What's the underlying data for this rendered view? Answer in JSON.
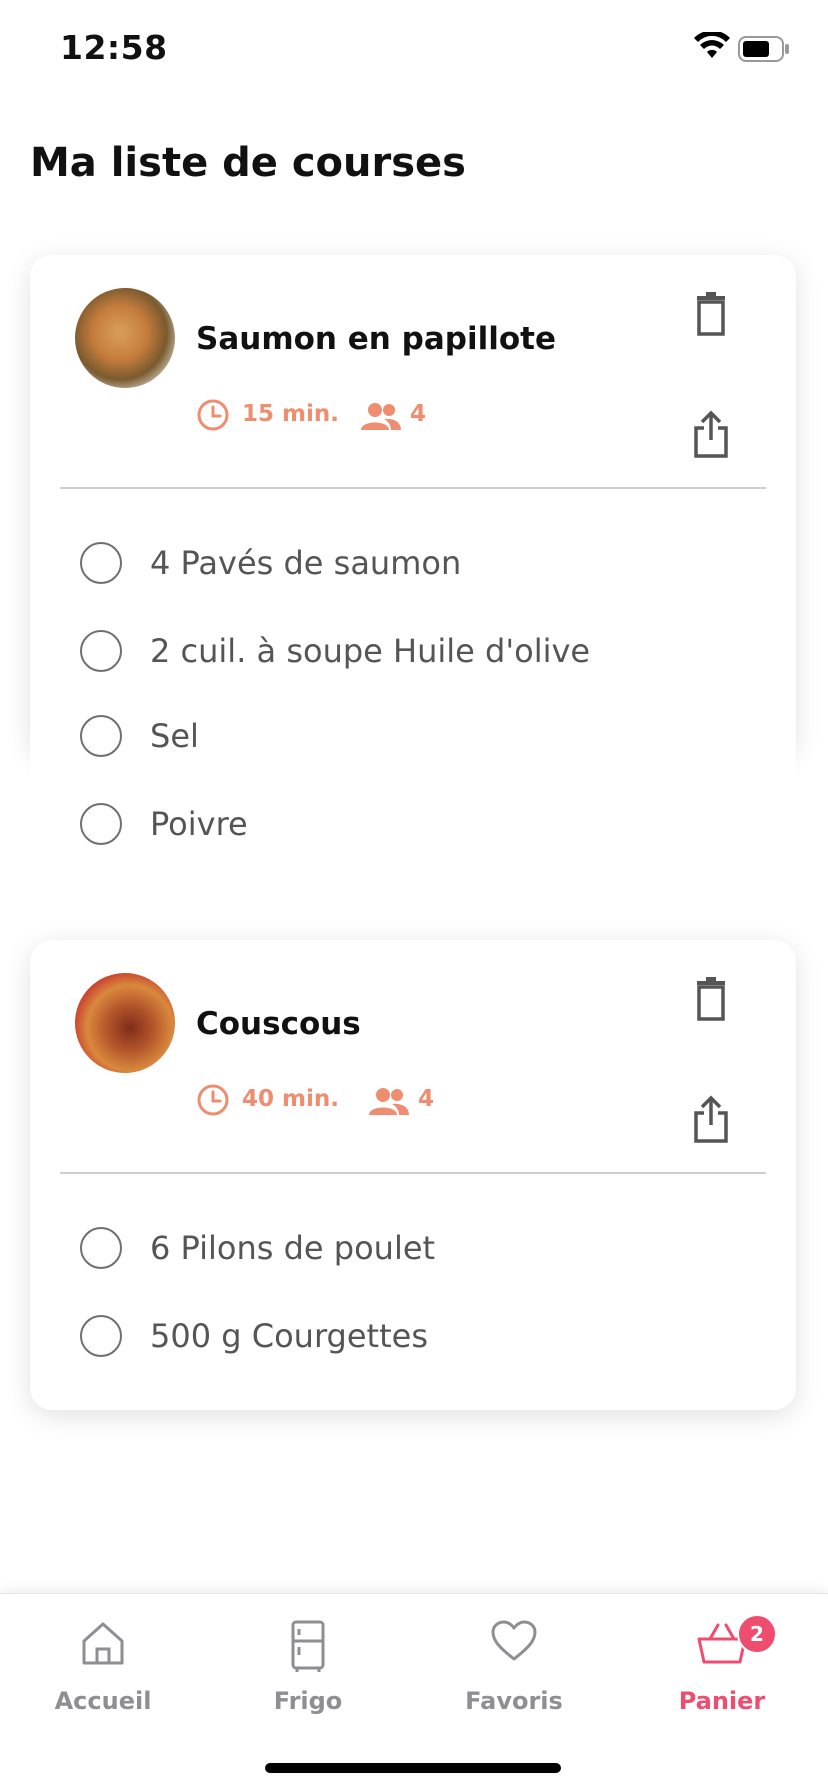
{
  "status_bar": {
    "time": "12:58",
    "wifi_icon": "wifi-icon",
    "battery_icon": "battery-icon"
  },
  "page": {
    "title": "Ma liste de courses"
  },
  "recipes": [
    {
      "title": "Saumon en papillote",
      "time": "15 min.",
      "servings": "4",
      "ingredients": [
        "4 Pavés de saumon",
        "2 cuil. à soupe Huile d'olive",
        "Sel",
        "Poivre"
      ]
    },
    {
      "title": "Couscous",
      "time": "40 min.",
      "servings": "4",
      "ingredients": [
        "6 Pilons de poulet",
        "500 g Courgettes"
      ]
    }
  ],
  "tabbar": {
    "tabs": [
      {
        "label": "Accueil",
        "icon": "home-icon"
      },
      {
        "label": "Frigo",
        "icon": "fridge-icon"
      },
      {
        "label": "Favoris",
        "icon": "heart-icon"
      },
      {
        "label": "Panier",
        "icon": "basket-icon",
        "badge": "2"
      }
    ],
    "active": "Panier"
  },
  "colors": {
    "accent": "#ee8d6f",
    "active_tab": "#ee4d6f",
    "text_muted": "#555555"
  }
}
